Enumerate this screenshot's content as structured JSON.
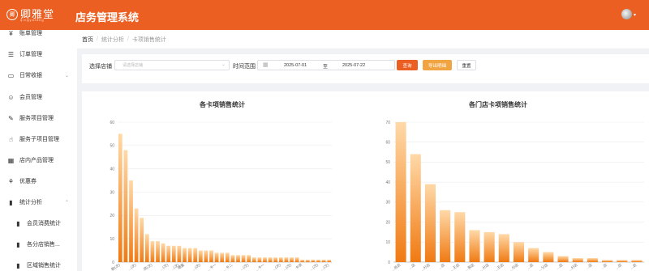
{
  "header": {
    "logo_text": "卿雅堂",
    "logo_mark": "卿",
    "logo_sub": "qingyatang",
    "title": "店务管理系统"
  },
  "sidebar": {
    "items": [
      {
        "label": "账单管理",
        "icon": "wallet-icon",
        "glyph": "¥"
      },
      {
        "label": "订单管理",
        "icon": "order-icon",
        "glyph": "☰"
      },
      {
        "label": "日常收银",
        "icon": "cash-icon",
        "glyph": "▭",
        "caret": "⌄"
      },
      {
        "label": "会员管理",
        "icon": "member-icon",
        "glyph": "☺"
      },
      {
        "label": "服务项目管理",
        "icon": "edit-icon",
        "glyph": "✎"
      },
      {
        "label": "服务子项目管理",
        "icon": "thumb-icon",
        "glyph": "☝"
      },
      {
        "label": "店内产品管理",
        "icon": "grid-icon",
        "glyph": "▦"
      },
      {
        "label": "优惠券",
        "icon": "coupon-icon",
        "glyph": "⚘"
      },
      {
        "label": "统计分析",
        "icon": "bar-chart-icon",
        "glyph": "▮",
        "caret": "⌃"
      },
      {
        "label": "会员消费统计",
        "icon": "bar-chart-icon",
        "glyph": "▮"
      },
      {
        "label": "各分店销售...",
        "icon": "bar-chart-icon",
        "glyph": "▮"
      },
      {
        "label": "区域销售统计",
        "icon": "bar-chart-icon",
        "glyph": "▮"
      }
    ]
  },
  "breadcrumb": [
    "首页",
    "统计分析",
    "卡项销售统计"
  ],
  "filter": {
    "store_label": "选择店铺",
    "store_placeholder": "请选择店铺",
    "time_label": "时间范围",
    "start_date": "2025-07-01",
    "date_separator": "至",
    "end_date": "2025-07-22",
    "search_label": "查询",
    "export_label": "导出明细",
    "reset_label": "重置"
  },
  "chart_data": [
    {
      "type": "bar",
      "title": "各卡项销售统计",
      "ylim": [
        0,
        60
      ],
      "yticks": [
        0,
        10,
        20,
        30,
        40,
        50,
        60
      ],
      "categories": [
        "...数(次)",
        "",
        "",
        "...(次)",
        "",
        "",
        "...项(次)",
        "",
        "",
        "...(次)",
        "",
        "...(次)",
        "储蓄",
        "",
        "",
        "...(次)",
        "",
        "",
        "...卡一",
        "",
        "",
        "...卡二",
        "",
        "",
        "...(次)",
        "",
        "",
        "...卡一",
        "",
        "",
        "...(次)",
        "",
        "...(次)",
        "",
        "卡项",
        "",
        "",
        "...(次)",
        "",
        "...(次)"
      ],
      "values": [
        55,
        48,
        35,
        23,
        19,
        12,
        9,
        9,
        8,
        7,
        7,
        7,
        6,
        6,
        6,
        5,
        5,
        5,
        4,
        4,
        4,
        3,
        3,
        3,
        3,
        2,
        2,
        2,
        2,
        2,
        2,
        2,
        2,
        2,
        1,
        1,
        1,
        1,
        1,
        1
      ],
      "grid": true,
      "color_top": "#ffd9a8",
      "color_bottom": "#f07a12"
    },
    {
      "type": "bar",
      "title": "各门店卡项销售统计",
      "ylim": [
        0,
        70
      ],
      "yticks": [
        0,
        10,
        20,
        30,
        40,
        50,
        60,
        70
      ],
      "categories": [
        "...总店",
        "...店",
        "...分店",
        "...店",
        "...王店",
        "...泉店",
        "...分店",
        "...王店",
        "...分店",
        "...店",
        "...分店",
        "...店",
        "...分店",
        "...店",
        "...店",
        "...店",
        "...店"
      ],
      "values": [
        70,
        54,
        39,
        26,
        25,
        16,
        15,
        14,
        10,
        7,
        5,
        3,
        2,
        2,
        1,
        1,
        1
      ],
      "grid": true,
      "color_top": "#ffd9a8",
      "color_bottom": "#f07a12"
    }
  ]
}
